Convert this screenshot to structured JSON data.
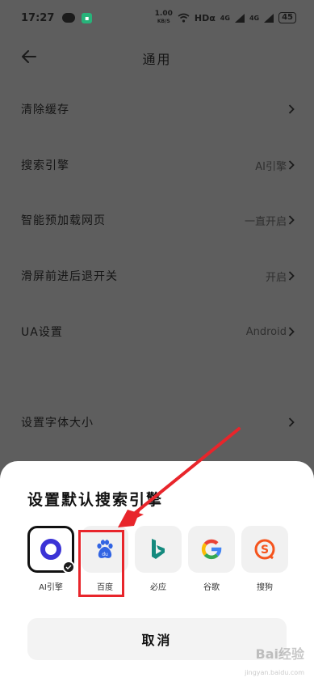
{
  "status_bar": {
    "time": "17:27",
    "speed_value": "1.00",
    "speed_unit": "KB/S",
    "hd": "HDα",
    "signal1": "4G",
    "signal2": "4G",
    "battery": "45"
  },
  "header": {
    "title": "通用",
    "back_icon": "arrow-left-icon"
  },
  "settings": [
    {
      "label": "清除缓存",
      "value": ""
    },
    {
      "label": "搜索引擎",
      "value": "AI引擎"
    },
    {
      "label": "智能预加载网页",
      "value": "一直开启"
    },
    {
      "label": "滑屏前进后退开关",
      "value": "开启"
    },
    {
      "label": "UA设置",
      "value": "Android"
    },
    {
      "label": "设置字体大小",
      "value": ""
    }
  ],
  "sheet": {
    "title": "设置默认搜索引擎",
    "engines": [
      {
        "name": "AI引擎",
        "selected": true,
        "color": "#3b33d6"
      },
      {
        "name": "百度",
        "selected": false,
        "color": "#3164e3"
      },
      {
        "name": "必应",
        "selected": false,
        "color": "#148a7e"
      },
      {
        "name": "谷歌",
        "selected": false,
        "color": "#4285f4"
      },
      {
        "name": "搜狗",
        "selected": false,
        "color": "#f5541d"
      }
    ],
    "cancel_label": "取消"
  },
  "annotation": {
    "box_color": "#e8252b",
    "target": "百度"
  },
  "watermark": {
    "text": "Bai经验",
    "sub": "jingyan.baidu.com"
  }
}
